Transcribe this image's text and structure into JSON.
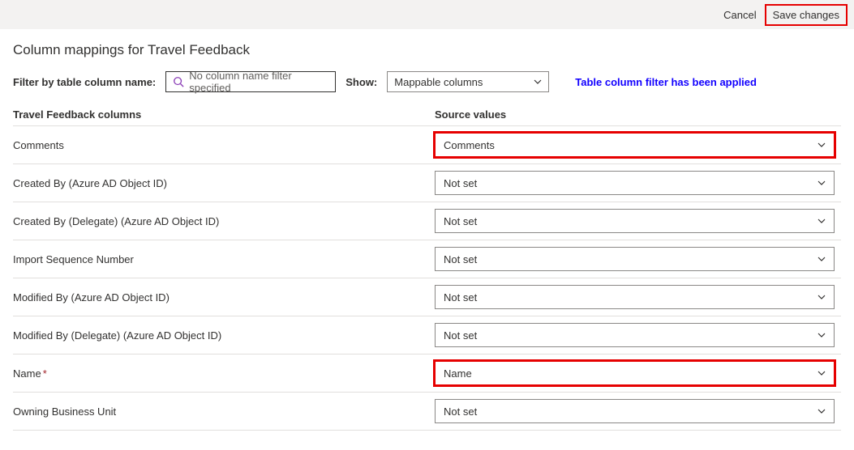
{
  "topBar": {
    "cancel": "Cancel",
    "save": "Save changes"
  },
  "pageTitle": "Column mappings for Travel Feedback",
  "filter": {
    "label": "Filter by table column name:",
    "placeholder": "No column name filter specified",
    "showLabel": "Show:",
    "showValue": "Mappable columns",
    "appliedMsg": "Table column filter has been applied"
  },
  "headers": {
    "left": "Travel Feedback columns",
    "right": "Source values"
  },
  "rows": [
    {
      "label": "Comments",
      "required": false,
      "source": "Comments",
      "highlight": true
    },
    {
      "label": "Created By (Azure AD Object ID)",
      "required": false,
      "source": "Not set",
      "highlight": false
    },
    {
      "label": "Created By (Delegate) (Azure AD Object ID)",
      "required": false,
      "source": "Not set",
      "highlight": false
    },
    {
      "label": "Import Sequence Number",
      "required": false,
      "source": "Not set",
      "highlight": false
    },
    {
      "label": "Modified By (Azure AD Object ID)",
      "required": false,
      "source": "Not set",
      "highlight": false
    },
    {
      "label": "Modified By (Delegate) (Azure AD Object ID)",
      "required": false,
      "source": "Not set",
      "highlight": false
    },
    {
      "label": "Name",
      "required": true,
      "source": "Name",
      "highlight": true
    },
    {
      "label": "Owning Business Unit",
      "required": false,
      "source": "Not set",
      "highlight": false
    }
  ],
  "requiredMark": "*"
}
